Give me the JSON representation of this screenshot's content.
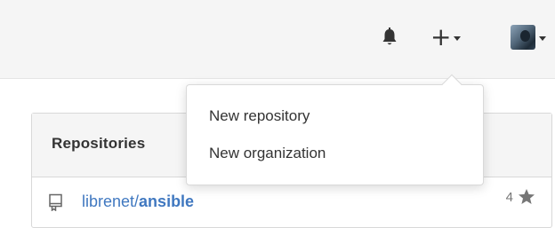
{
  "header": {
    "icons": {
      "notifications": "bell-icon",
      "create": "plus-icon",
      "menu_caret": "chevron-down-icon"
    },
    "create_glyph": "+"
  },
  "create_menu": {
    "items": [
      {
        "label": "New repository"
      },
      {
        "label": "New organization"
      }
    ]
  },
  "repositories": {
    "title": "Repositories",
    "items": [
      {
        "owner": "librenet/",
        "name": "ansible",
        "stars": "4",
        "icon": "repo-icon"
      }
    ]
  },
  "colors": {
    "link": "#4078c0",
    "header_bg": "#f5f5f5",
    "text": "#333333",
    "muted": "#767676"
  }
}
